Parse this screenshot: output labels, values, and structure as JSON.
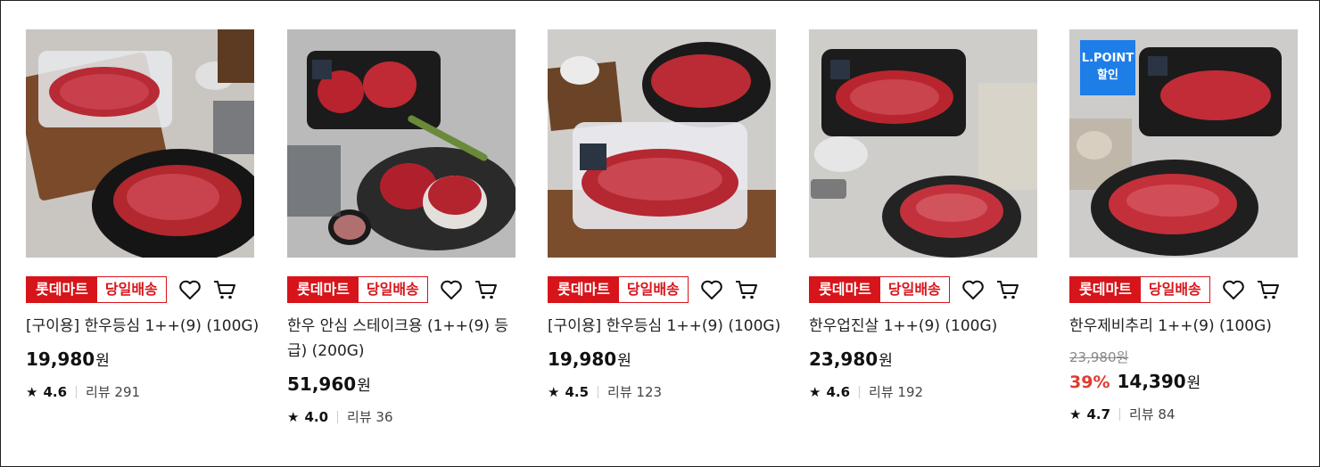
{
  "products": [
    {
      "badge_store": "롯데마트",
      "badge_delivery": "당일배송",
      "title": "[구이용] 한우등심 1++(9) (100G)",
      "price": "19,980",
      "currency": "원",
      "rating": "4.6",
      "reviews_label": "리뷰",
      "reviews": "291",
      "image": "sirloin-steak-photo"
    },
    {
      "badge_store": "롯데마트",
      "badge_delivery": "당일배송",
      "title": "한우 안심 스테이크용 (1++(9) 등급) (200G)",
      "price": "51,960",
      "currency": "원",
      "rating": "4.0",
      "reviews_label": "리뷰",
      "reviews": "36",
      "image": "tenderloin-steak-photo"
    },
    {
      "badge_store": "롯데마트",
      "badge_delivery": "당일배송",
      "title": "[구이용] 한우등심 1++(9) (100G)",
      "price": "19,980",
      "currency": "원",
      "rating": "4.5",
      "reviews_label": "리뷰",
      "reviews": "123",
      "image": "sirloin-tray-photo"
    },
    {
      "badge_store": "롯데마트",
      "badge_delivery": "당일배송",
      "title": "한우업진살 1++(9) (100G)",
      "price": "23,980",
      "currency": "원",
      "rating": "4.6",
      "reviews_label": "리뷰",
      "reviews": "192",
      "image": "flank-cut-photo"
    },
    {
      "badge_store": "롯데마트",
      "badge_delivery": "당일배송",
      "promo_line1": "L.POINT",
      "promo_line2": "할인",
      "title": "한우제비추리 1++(9) (100G)",
      "original_price": "23,980",
      "original_currency": "원",
      "discount": "39%",
      "price": "14,390",
      "currency": "원",
      "rating": "4.7",
      "reviews_label": "리뷰",
      "reviews": "84",
      "image": "short-rib-strips-photo"
    }
  ],
  "colors": {
    "brand_red": "#d7141a",
    "sale_red": "#e03c31",
    "promo_blue": "#1e7ee8"
  },
  "icons": {
    "wishlist": "heart-icon",
    "cart": "cart-icon",
    "rating": "star-icon"
  }
}
